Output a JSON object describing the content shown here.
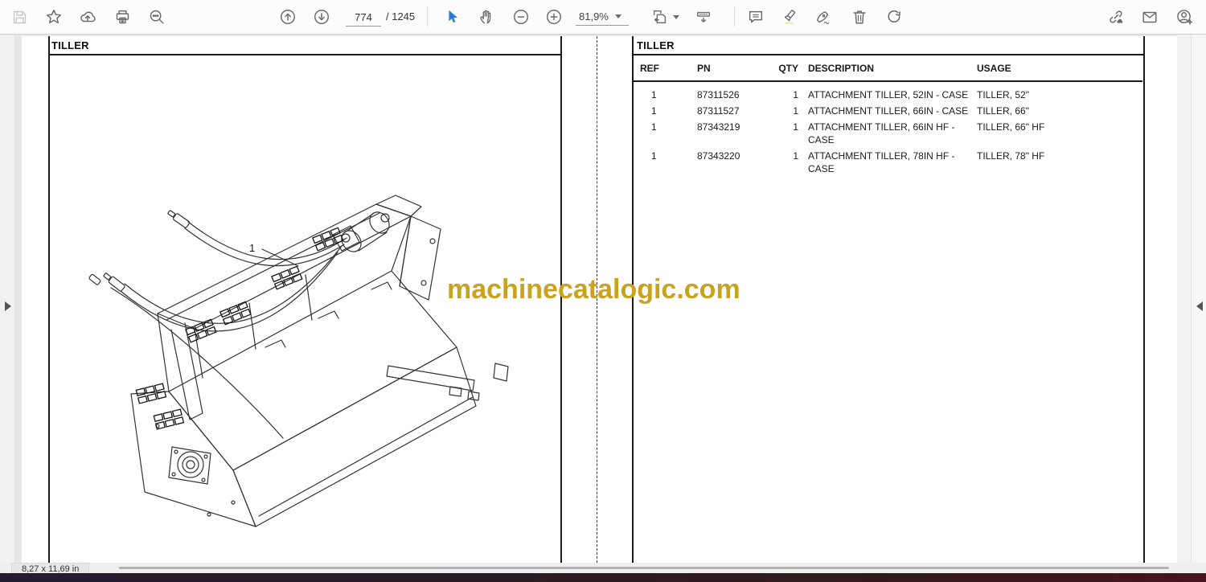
{
  "toolbar": {
    "page_current": "774",
    "page_total": "/ 1245",
    "zoom_level": "81,9%",
    "icon_names": [
      "save-icon",
      "favorite-icon",
      "upload-icon",
      "print-icon",
      "search-icon",
      "page-up-icon",
      "page-down-icon",
      "select-tool-icon",
      "hand-tool-icon",
      "zoom-out-icon",
      "zoom-in-icon",
      "zoom-level-dropdown",
      "fit-page-icon",
      "hide-toolbar-icon",
      "comment-icon",
      "highlight-icon",
      "signature-icon",
      "delete-icon",
      "rotate-icon",
      "share-link-icon",
      "email-icon",
      "add-account-icon"
    ]
  },
  "document": {
    "watermark": "machinecatalogic.com",
    "left_page": {
      "title": "TILLER",
      "figure_label": "1"
    },
    "right_page": {
      "title": "TILLER",
      "table": {
        "headers": [
          "REF",
          "PN",
          "QTY",
          "DESCRIPTION",
          "USAGE"
        ],
        "rows": [
          {
            "ref": "1",
            "pn": "87311526",
            "qty": "1",
            "description": "ATTACHMENT TILLER, 52IN - CASE",
            "usage": "TILLER, 52\""
          },
          {
            "ref": "1",
            "pn": "87311527",
            "qty": "1",
            "description": "ATTACHMENT TILLER, 66IN - CASE",
            "usage": "TILLER, 66\""
          },
          {
            "ref": "1",
            "pn": "87343219",
            "qty": "1",
            "description": "ATTACHMENT TILLER, 66IN HF - CASE",
            "usage": "TILLER, 66\" HF"
          },
          {
            "ref": "1",
            "pn": "87343220",
            "qty": "1",
            "description": "ATTACHMENT TILLER, 78IN HF - CASE",
            "usage": "TILLER, 78\" HF"
          }
        ]
      }
    }
  },
  "statusbar": {
    "page_size": "8,27 x 11,69 in"
  },
  "colors": {
    "watermark_gold": "#c9a21f",
    "selection_blue": "#2b7bd4",
    "toolbar_icon_gray": "#6b6b6b"
  }
}
